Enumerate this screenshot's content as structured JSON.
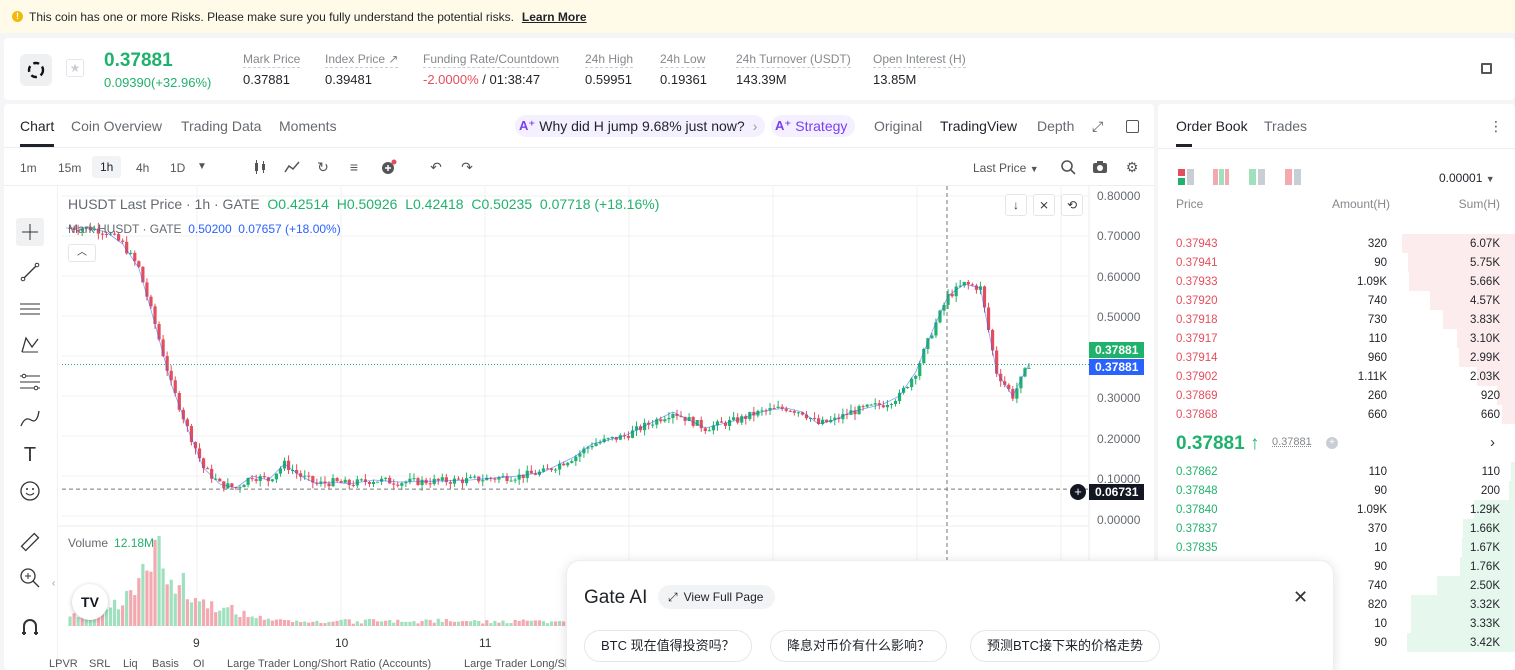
{
  "warning": {
    "text": "This coin has one or more Risks. Please make sure you fully understand the potential risks.",
    "link": "Learn More"
  },
  "ticker": {
    "price": "0.37881",
    "change": "0.09390(+32.96%)",
    "stats": [
      {
        "label": "Mark Price",
        "value": "0.37881"
      },
      {
        "label": "Index Price ↗",
        "value": "0.39481"
      },
      {
        "label": "Funding Rate/Countdown",
        "value_red": "-2.0000%",
        "value": " / 01:38:47"
      },
      {
        "label": "24h High",
        "value": "0.59951"
      },
      {
        "label": "24h Low",
        "value": "0.19361"
      },
      {
        "label": "24h Turnover (USDT)",
        "value": "143.39M"
      },
      {
        "label": "Open Interest (H)",
        "value": "13.85M"
      }
    ]
  },
  "chart_tabs": {
    "left": [
      "Chart",
      "Coin Overview",
      "Trading Data",
      "Moments"
    ],
    "ai_question": "Why did H jump 9.68% just now?",
    "ai_strategy": "Strategy",
    "right": [
      "Original",
      "TradingView",
      "Depth"
    ]
  },
  "toolbar": {
    "timeframes": [
      "1m",
      "15m",
      "1h",
      "4h",
      "1D"
    ],
    "price_type": "Last Price"
  },
  "legend": {
    "title": "HUSDT Last Price · 1h · GATE",
    "o": "O0.42514",
    "h": "H0.50926",
    "l": "L0.42418",
    "c": "C0.50235",
    "chg": "0.07718 (+18.16%)",
    "mark_label": "Mark HUSDT · GATE",
    "mark_val": "0.50200",
    "mark_chg": "0.07657 (+18.00%)"
  },
  "price_tags": {
    "last": "0.37881",
    "mark": "0.37881",
    "cursor": "0.06731"
  },
  "volume": {
    "label": "Volume",
    "value": "12.18M"
  },
  "indicators": [
    "LPVR",
    "SRL",
    "Liq",
    "Basis",
    "OI",
    "Large Trader Long/Short Ratio (Accounts)",
    "Large Trader Long/Short Ratio"
  ],
  "chart_data": {
    "type": "candlestick",
    "title": "HUSDT Last Price · 1h · GATE",
    "x_ticks": [
      "9",
      "10",
      "11"
    ],
    "y_ticks": [
      "0.80000",
      "0.70000",
      "0.60000",
      "0.50000",
      "0.30000",
      "0.20000",
      "0.10000",
      "0.00000"
    ],
    "ylim": [
      0,
      0.8
    ],
    "last_price": 0.37881,
    "cursor_price": 0.06731,
    "close_path": [
      [
        0,
        0.72
      ],
      [
        6,
        0.72
      ],
      [
        10,
        0.71
      ],
      [
        14,
        0.68
      ],
      [
        18,
        0.62
      ],
      [
        22,
        0.48
      ],
      [
        26,
        0.33
      ],
      [
        30,
        0.22
      ],
      [
        34,
        0.12
      ],
      [
        38,
        0.08
      ],
      [
        42,
        0.07
      ],
      [
        46,
        0.1
      ],
      [
        50,
        0.09
      ],
      [
        54,
        0.13
      ],
      [
        58,
        0.1
      ],
      [
        62,
        0.08
      ],
      [
        66,
        0.085
      ],
      [
        70,
        0.08
      ],
      [
        76,
        0.09
      ],
      [
        82,
        0.085
      ],
      [
        88,
        0.086
      ],
      [
        94,
        0.088
      ],
      [
        100,
        0.09
      ],
      [
        106,
        0.095
      ],
      [
        112,
        0.1
      ],
      [
        118,
        0.11
      ],
      [
        122,
        0.13
      ],
      [
        126,
        0.15
      ],
      [
        130,
        0.18
      ],
      [
        134,
        0.19
      ],
      [
        138,
        0.2
      ],
      [
        142,
        0.22
      ],
      [
        146,
        0.24
      ],
      [
        150,
        0.26
      ],
      [
        154,
        0.24
      ],
      [
        158,
        0.22
      ],
      [
        162,
        0.23
      ],
      [
        166,
        0.24
      ],
      [
        170,
        0.255
      ],
      [
        174,
        0.265
      ],
      [
        178,
        0.27
      ],
      [
        182,
        0.26
      ],
      [
        186,
        0.23
      ],
      [
        190,
        0.24
      ],
      [
        194,
        0.26
      ],
      [
        198,
        0.27
      ],
      [
        202,
        0.28
      ],
      [
        206,
        0.3
      ],
      [
        210,
        0.36
      ],
      [
        214,
        0.46
      ],
      [
        218,
        0.55
      ],
      [
        222,
        0.58
      ],
      [
        226,
        0.57
      ],
      [
        230,
        0.36
      ],
      [
        234,
        0.3
      ],
      [
        238,
        0.38
      ]
    ],
    "volume_peaks": [
      0.12,
      0.15,
      0.2,
      0.25,
      0.3,
      0.45,
      0.6,
      0.95,
      0.7,
      0.5,
      0.35,
      0.3,
      0.25,
      0.2,
      0.15,
      0.12,
      0.1,
      0.08,
      0.06,
      0.05
    ]
  },
  "orderbook": {
    "tabs": [
      "Order Book",
      "Trades"
    ],
    "precision": "0.00001",
    "headers": [
      "Price",
      "Amount(H)",
      "Sum(H)"
    ],
    "asks": [
      {
        "price": "0.37943",
        "amount": "320",
        "sum": "6.07K",
        "fill": 0.94
      },
      {
        "price": "0.37941",
        "amount": "90",
        "sum": "5.75K",
        "fill": 0.89
      },
      {
        "price": "0.37933",
        "amount": "1.09K",
        "sum": "5.66K",
        "fill": 0.88
      },
      {
        "price": "0.37920",
        "amount": "740",
        "sum": "4.57K",
        "fill": 0.71
      },
      {
        "price": "0.37918",
        "amount": "730",
        "sum": "3.83K",
        "fill": 0.6
      },
      {
        "price": "0.37917",
        "amount": "110",
        "sum": "3.10K",
        "fill": 0.48
      },
      {
        "price": "0.37914",
        "amount": "960",
        "sum": "2.99K",
        "fill": 0.47
      },
      {
        "price": "0.37902",
        "amount": "1.11K",
        "sum": "2.03K",
        "fill": 0.32
      },
      {
        "price": "0.37869",
        "amount": "260",
        "sum": "920",
        "fill": 0.15
      },
      {
        "price": "0.37868",
        "amount": "660",
        "sum": "660",
        "fill": 0.11
      }
    ],
    "mid_price": "0.37881 ↑",
    "mid_mark": "0.37881",
    "bids": [
      {
        "price": "0.37862",
        "amount": "110",
        "sum": "110",
        "fill": 0.03
      },
      {
        "price": "0.37848",
        "amount": "90",
        "sum": "200",
        "fill": 0.05
      },
      {
        "price": "0.37840",
        "amount": "1.09K",
        "sum": "1.29K",
        "fill": 0.34
      },
      {
        "price": "0.37837",
        "amount": "370",
        "sum": "1.66K",
        "fill": 0.43
      },
      {
        "price": "0.37835",
        "amount": "10",
        "sum": "1.67K",
        "fill": 0.44
      },
      {
        "price": "",
        "amount": "90",
        "sum": "1.76K",
        "fill": 0.46
      },
      {
        "price": "",
        "amount": "740",
        "sum": "2.50K",
        "fill": 0.65
      },
      {
        "price": "",
        "amount": "820",
        "sum": "3.32K",
        "fill": 0.87
      },
      {
        "price": "",
        "amount": "10",
        "sum": "3.33K",
        "fill": 0.87
      },
      {
        "price": "",
        "amount": "90",
        "sum": "3.42K",
        "fill": 0.9
      }
    ]
  },
  "ai_panel": {
    "title": "Gate AI",
    "view_full": "View Full Page",
    "questions": [
      "BTC 现在值得投资吗？",
      "降息对币价有什么影响？",
      "预测BTC接下来的价格走势"
    ]
  },
  "colors": {
    "up": "#20b26c",
    "down": "#e44e5c",
    "accent": "#7b3ff2"
  }
}
